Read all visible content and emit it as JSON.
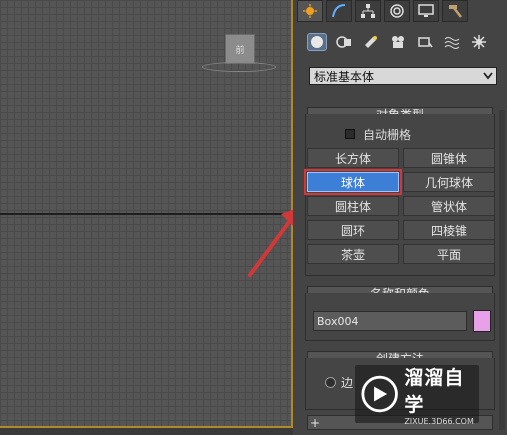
{
  "viewport": {
    "viewcube_label": "前"
  },
  "panel": {
    "tabs": [
      "create-tab",
      "modify-tab",
      "hierarchy-tab",
      "motion-tab",
      "display-tab",
      "utilities-tab"
    ],
    "subcategories": [
      "geometry",
      "shapes",
      "lights",
      "cameras",
      "helpers",
      "space-warps",
      "systems"
    ],
    "dropdown_value": "标准基本体",
    "object_type": {
      "title": "对象类型",
      "autogrid_label": "自动栅格",
      "buttons": [
        {
          "label": "长方体",
          "active": false
        },
        {
          "label": "圆锥体",
          "active": false
        },
        {
          "label": "球体",
          "active": true
        },
        {
          "label": "几何球体",
          "active": false
        },
        {
          "label": "圆柱体",
          "active": false
        },
        {
          "label": "管状体",
          "active": false
        },
        {
          "label": "圆环",
          "active": false
        },
        {
          "label": "四棱锥",
          "active": false
        },
        {
          "label": "茶壶",
          "active": false
        },
        {
          "label": "平面",
          "active": false
        }
      ]
    },
    "name_color": {
      "title": "名称和颜色",
      "name_value": "Box004",
      "color": "#e8a0e8"
    },
    "creation_method": {
      "title": "创建方法",
      "option_label": "边"
    },
    "collapsed_sign": "+"
  },
  "watermark": {
    "title": "溜溜自学",
    "subtitle": "ZIXUE.3D66.COM"
  },
  "colors": {
    "accent": "#3d7ed6",
    "highlight_box": "#d23838",
    "arrow": "#d23838"
  }
}
